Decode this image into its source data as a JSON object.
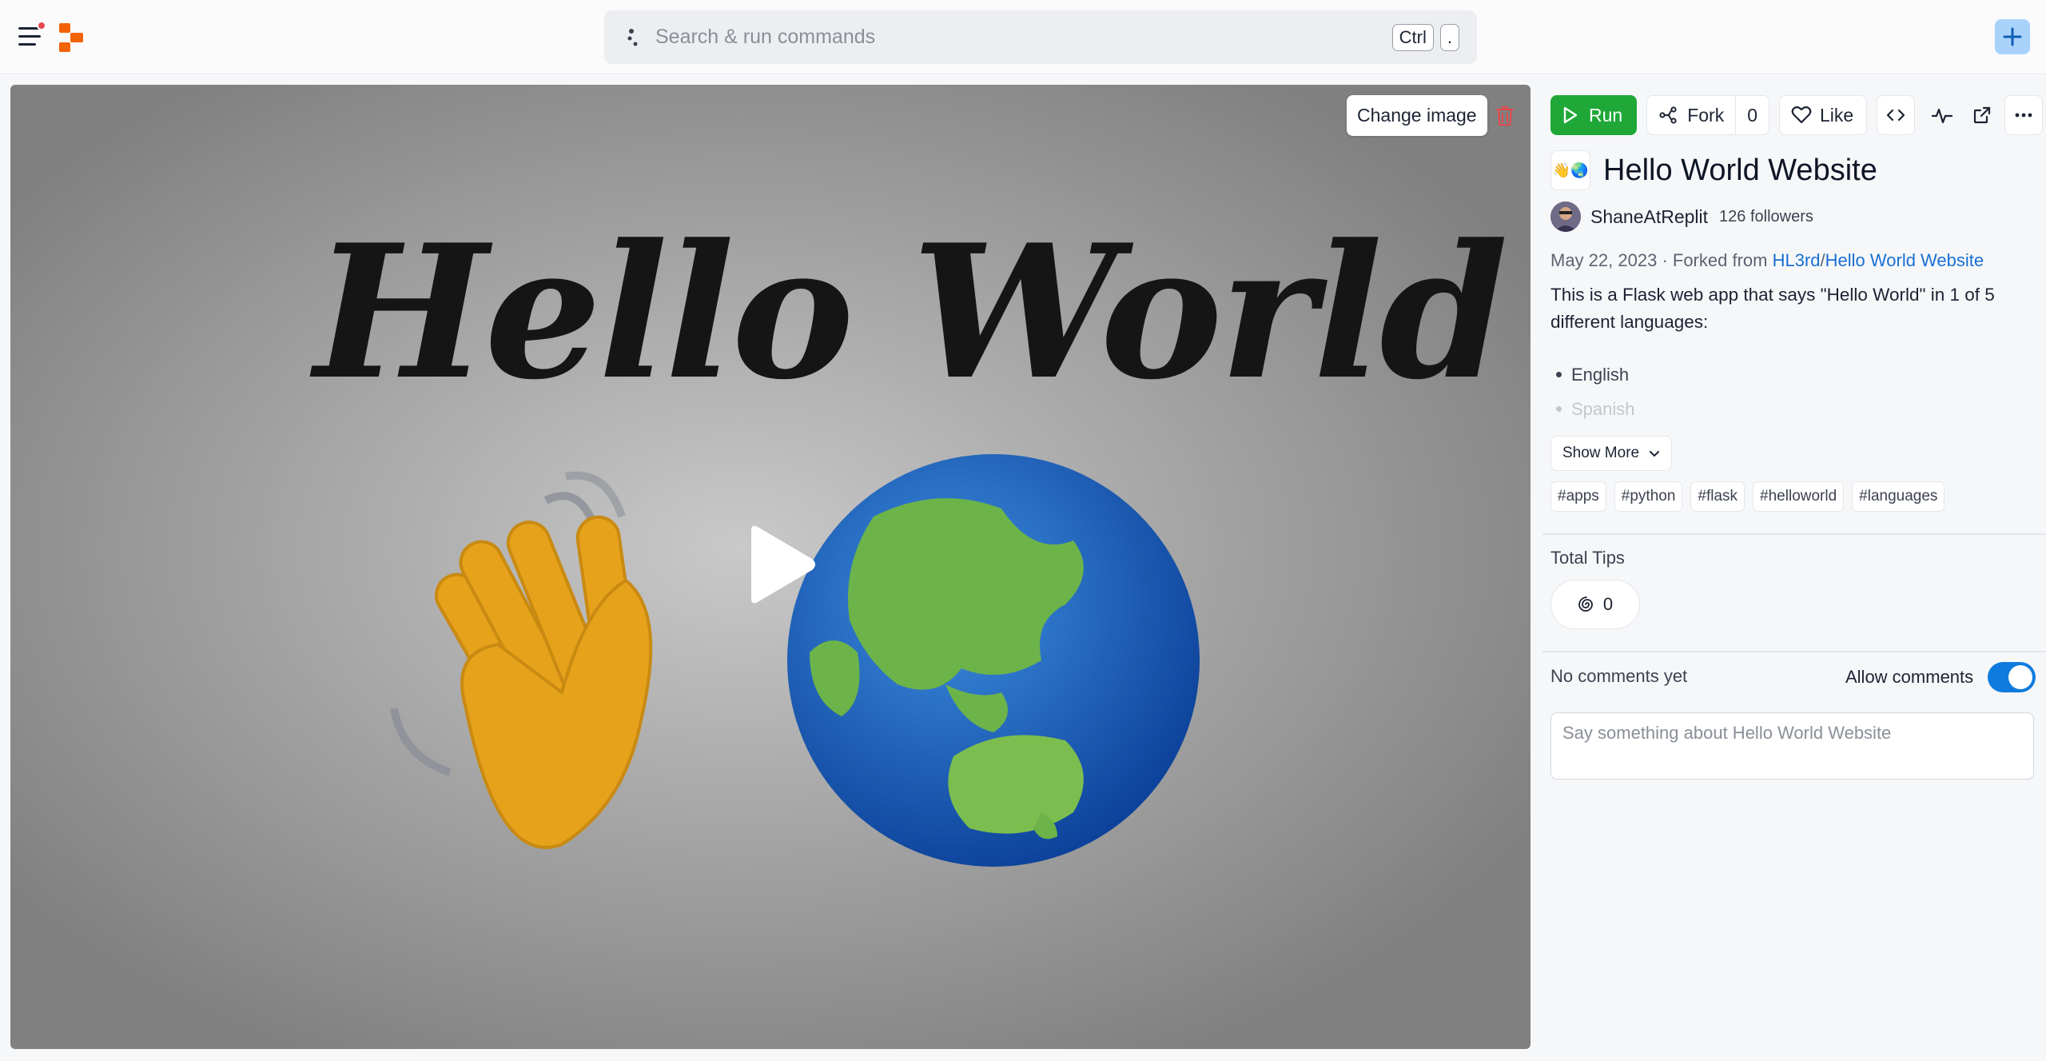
{
  "topbar": {
    "search_placeholder": "Search & run commands",
    "shortcut_keys": [
      "Ctrl",
      "."
    ]
  },
  "cover": {
    "change_image_label": "Change image",
    "image_text": "Hello World"
  },
  "actions": {
    "run_label": "Run",
    "fork_label": "Fork",
    "fork_count": "0",
    "like_label": "Like"
  },
  "repl": {
    "icon_emoji": "👋🌏",
    "title": "Hello World Website",
    "author": "ShaneAtReplit",
    "followers": "126 followers",
    "date": "May 22, 2023",
    "forked_from_text": "· Forked from",
    "fork_owner": "HL3rd",
    "fork_separator": "/",
    "fork_repl": "Hello World Website",
    "description": "This is a Flask web app that says \"Hello World\" in 1 of 5 different languages:",
    "languages": [
      "English",
      "Spanish"
    ],
    "show_more_label": "Show More",
    "tags": [
      "#apps",
      "#python",
      "#flask",
      "#helloworld",
      "#languages"
    ]
  },
  "tips": {
    "label": "Total Tips",
    "count": "0"
  },
  "comments": {
    "empty_text": "No comments yet",
    "allow_label": "Allow comments",
    "allow_enabled": true,
    "placeholder": "Say something about Hello World Website"
  },
  "colors": {
    "run_green": "#1fa838",
    "link_blue": "#1a6fd4",
    "toggle_blue": "#0f7bde",
    "brand_orange": "#f26207"
  }
}
